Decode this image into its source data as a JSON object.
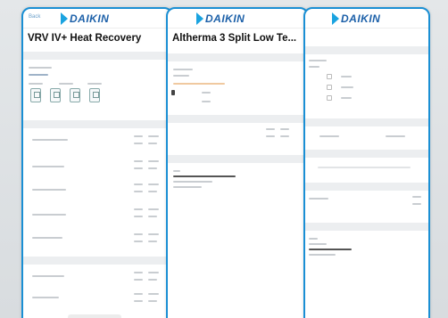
{
  "brand": {
    "logo_text": "DAIKIN",
    "accent": "#1a8fd4",
    "logo_color": "#1b5fa8"
  },
  "screens": [
    {
      "title": "VRV IV+ Heat Recovery",
      "back_label": "Back",
      "sections": [
        "Outdoor Units",
        "Key Features",
        "Design tips"
      ]
    },
    {
      "title": "Altherma 3 Split Low Te..."
    },
    {
      "title": ""
    }
  ]
}
